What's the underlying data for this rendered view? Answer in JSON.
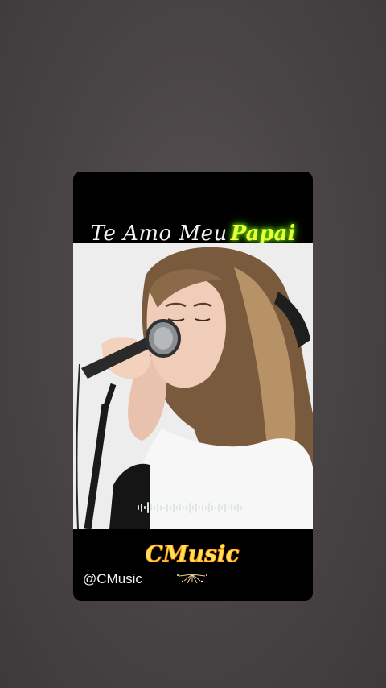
{
  "story": {
    "title_part1": "Te Amo Meu",
    "title_part2": "Papai",
    "handle": "@CMusic",
    "logo_text": "CMusic",
    "colors": {
      "page_background": "#4a4547",
      "card_background": "#000000",
      "highlight": "#e9ff3a"
    }
  }
}
